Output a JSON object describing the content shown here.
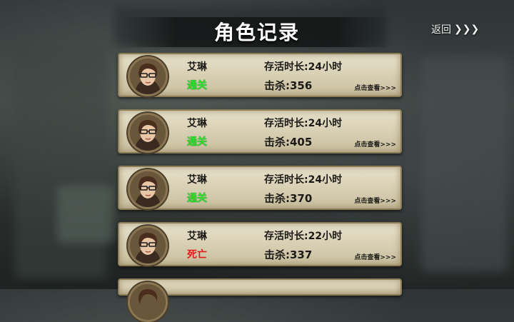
{
  "header": {
    "title": "角色记录",
    "back_label": "返回",
    "back_arrows": "❯❯❯"
  },
  "records": [
    {
      "name": "艾琳",
      "status": "通关",
      "status_type": "clear",
      "survival": "存活时长:24小时",
      "kills": "击杀:356",
      "view": "点击查看>>>"
    },
    {
      "name": "艾琳",
      "status": "通关",
      "status_type": "clear",
      "survival": "存活时长:24小时",
      "kills": "击杀:405",
      "view": "点击查看>>>"
    },
    {
      "name": "艾琳",
      "status": "通关",
      "status_type": "clear",
      "survival": "存活时长:24小时",
      "kills": "击杀:370",
      "view": "点击查看>>>"
    },
    {
      "name": "艾琳",
      "status": "死亡",
      "status_type": "dead",
      "survival": "存活时长:22小时",
      "kills": "击杀:337",
      "view": "点击查看>>>"
    }
  ],
  "colors": {
    "clear": "#2fe02f",
    "dead": "#e21a1a",
    "card_border": "#8c7c58"
  }
}
